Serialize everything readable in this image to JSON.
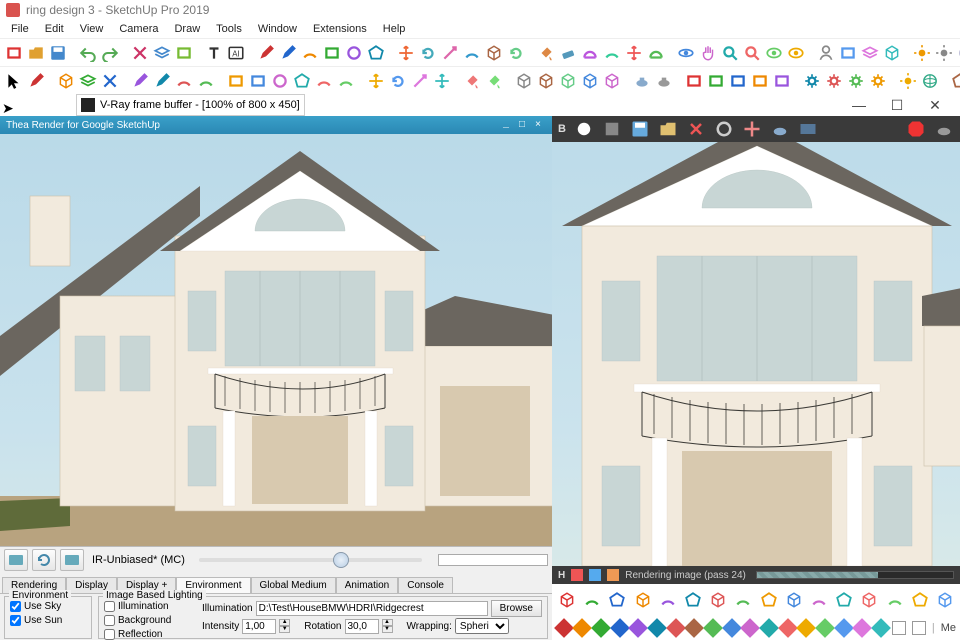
{
  "app": {
    "title": "ring design 3 - SketchUp Pro 2019"
  },
  "menu": [
    "File",
    "Edit",
    "View",
    "Camera",
    "Draw",
    "Tools",
    "Window",
    "Extensions",
    "Help"
  ],
  "vray_tab": {
    "title": "V-Ray frame buffer - [100% of 800 x 450]"
  },
  "vray_dark": {
    "channel": "B"
  },
  "thea": {
    "title": "Thea Render for Google SketchUp",
    "mode": "IR-Unbiased* (MC)",
    "tabs": [
      "Rendering",
      "Display",
      "Display +",
      "Environment",
      "Global Medium",
      "Animation",
      "Console"
    ],
    "active_tab": 3,
    "env": {
      "legend": "Environment",
      "use_sky": "Use Sky",
      "use_sun": "Use Sun"
    },
    "ibl": {
      "legend": "Image Based Lighting",
      "illumination": "Illumination",
      "background": "Background",
      "reflection": "Reflection",
      "label_illum": "Illumination",
      "path": "D:\\Test\\HouseBMW\\HDRI\\Ridgecrest",
      "browse": "Browse",
      "label_intensity": "Intensity",
      "intensity": "1,00",
      "label_rotation": "Rotation",
      "rotation": "30,0",
      "label_wrapping": "Wrapping:",
      "wrapping": "Spheri"
    }
  },
  "vray_status": {
    "text": "Rendering image (pass 24)"
  },
  "status": {
    "label": "Me"
  },
  "colors": {
    "row_a": [
      "#d33",
      "#48c",
      "#2a7",
      "#e80",
      "#95d",
      "#c36",
      "#4ab",
      "#e63",
      "#7b3",
      "#58d",
      "#d6a",
      "#39c",
      "#a64",
      "#6c8",
      "#d84",
      "#59b",
      "#b5d",
      "#3c9"
    ],
    "row_b": [
      "#000",
      "#e22",
      "#3a3",
      "#c80",
      "#26c",
      "#a4c",
      "#18a",
      "#d55",
      "#5b5",
      "#e90",
      "#48d",
      "#c6c",
      "#2aa",
      "#e66",
      "#6c6",
      "#ea0",
      "#59e",
      "#d7d",
      "#3bb",
      "#e77",
      "#7d7"
    ],
    "diamonds": [
      "#c33",
      "#e80",
      "#3a3",
      "#26c",
      "#95d",
      "#18a",
      "#d55",
      "#a64",
      "#5b5",
      "#48d",
      "#c6c",
      "#2aa",
      "#e66",
      "#ea0",
      "#6c6",
      "#59e",
      "#d7d",
      "#3bb"
    ]
  }
}
